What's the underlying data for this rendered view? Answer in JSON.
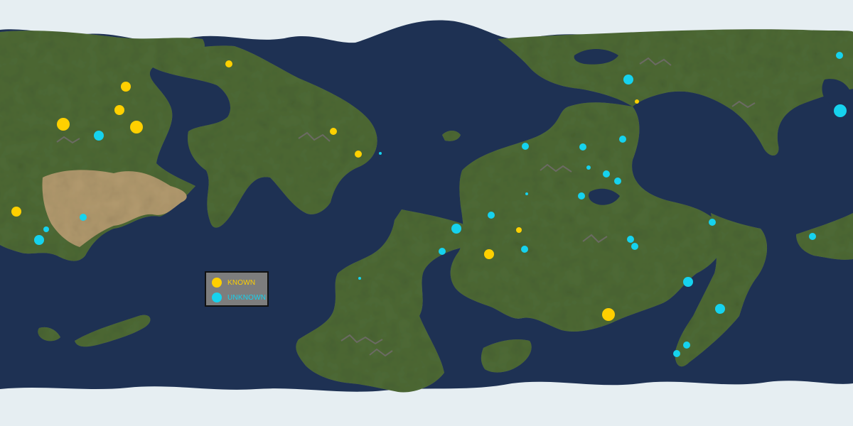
{
  "map": {
    "colors": {
      "ocean": "#1e3153",
      "land": "#4e6a35",
      "land_light": "#6b8447",
      "desert": "#b29a6e",
      "mountain": "#6b6a63",
      "ice": "#e6eef2",
      "lake": "#1e3153"
    }
  },
  "legend": {
    "known_label": "KNOWN",
    "unknown_label": "UNKNOWN",
    "known_color": "#ffd000",
    "unknown_color": "#16d2ee"
  }
}
